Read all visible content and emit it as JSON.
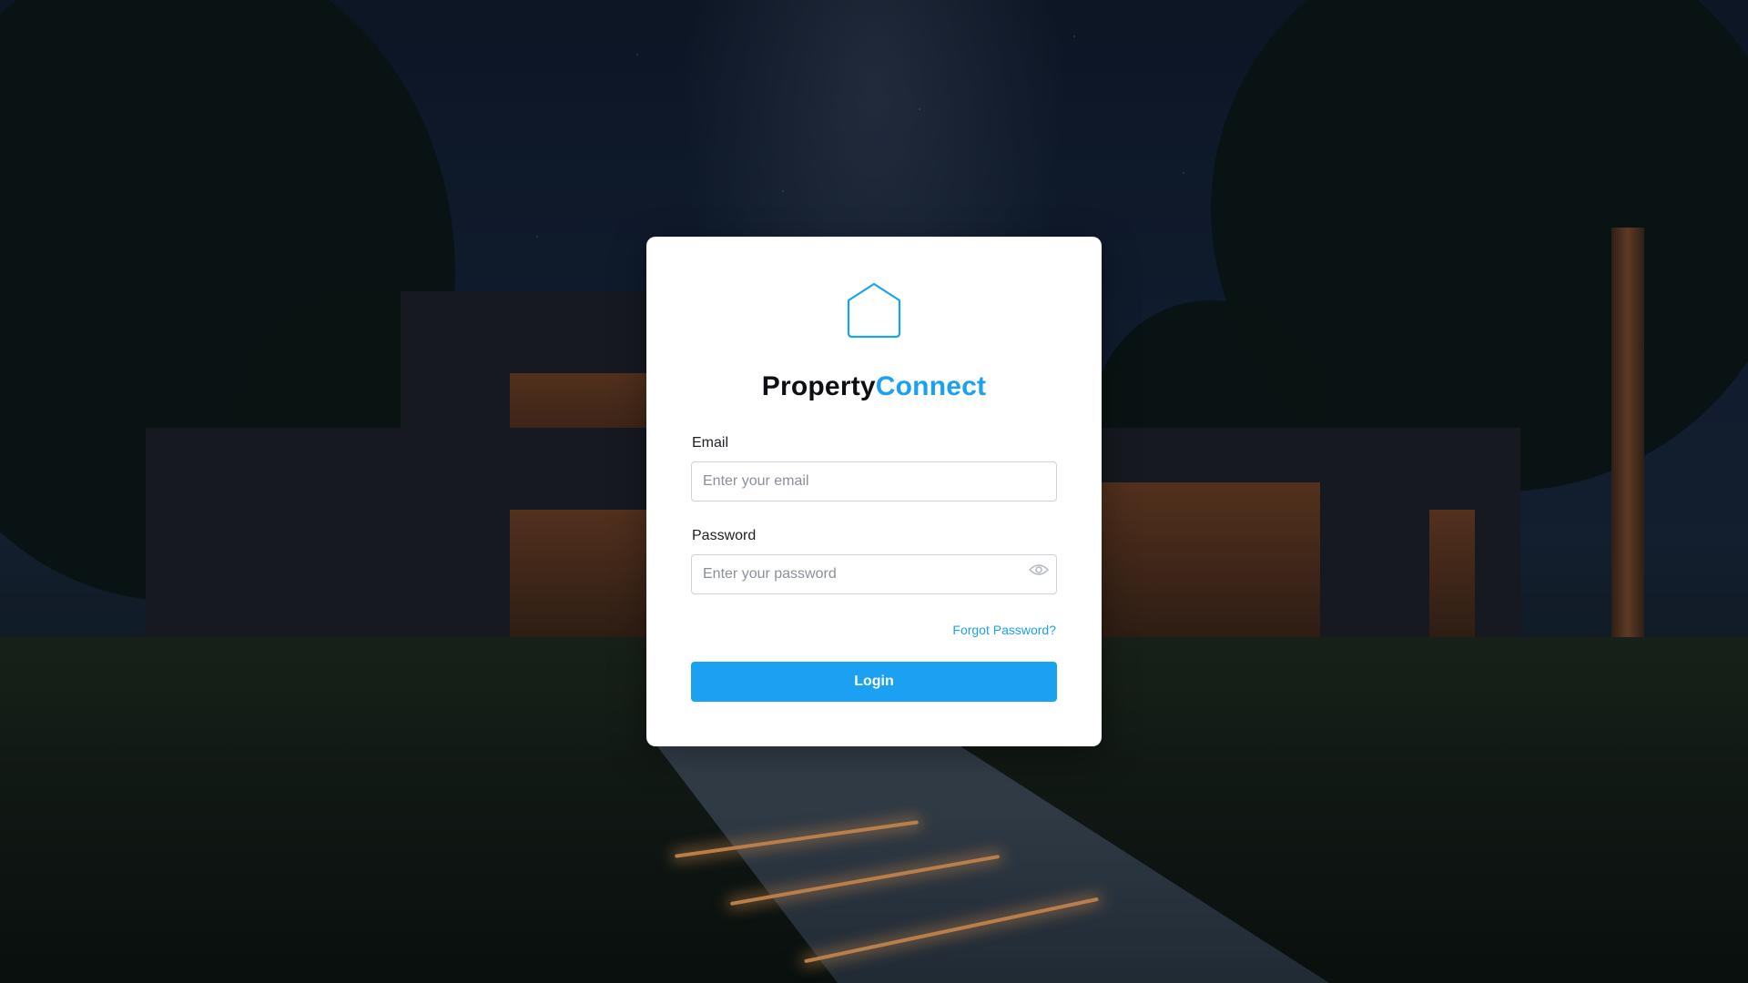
{
  "brand": {
    "name_primary": "Property",
    "name_accent": "Connect",
    "logo_icon": "house-outline-icon",
    "accent_color": "#1ba0f2"
  },
  "form": {
    "email_label": "Email",
    "email_placeholder": "Enter your email",
    "email_value": "",
    "password_label": "Password",
    "password_placeholder": "Enter your password",
    "password_value": "",
    "password_toggle_icon": "eye-icon",
    "forgot_password": "Forgot Password?",
    "login_button": "Login"
  },
  "background": {
    "scene": "modern house at night",
    "primary_color": "#1ba0f2"
  }
}
